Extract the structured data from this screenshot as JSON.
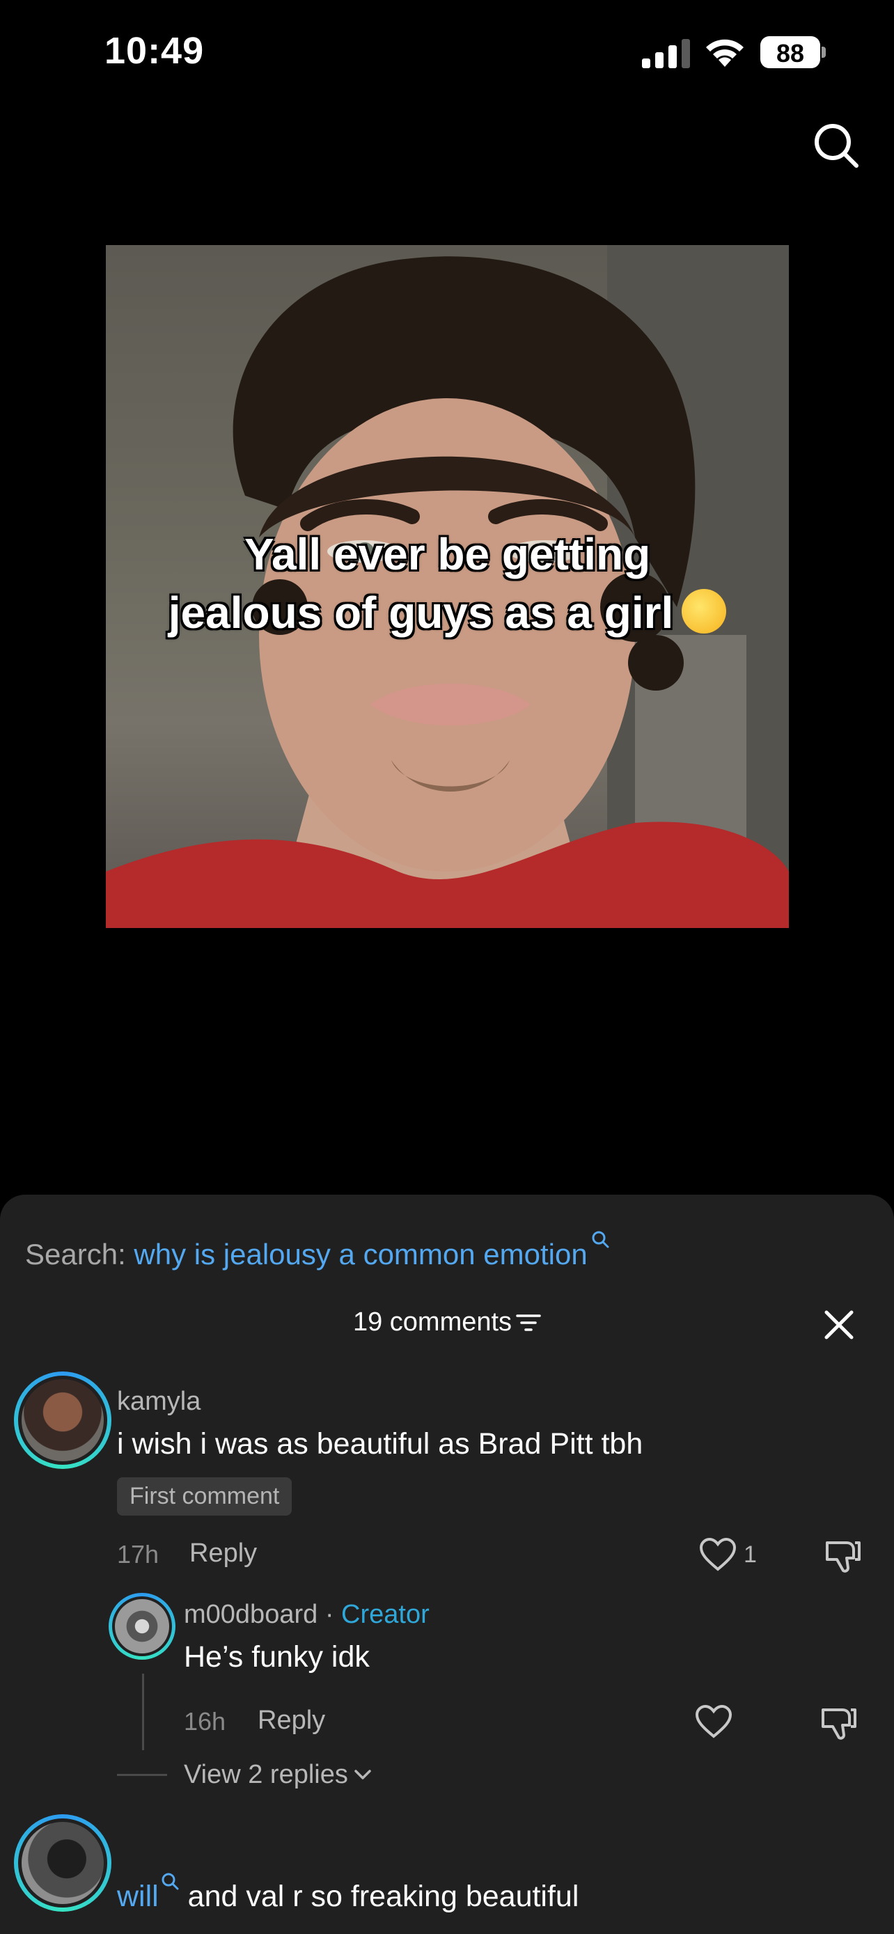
{
  "status_bar": {
    "time": "10:49",
    "battery": "88"
  },
  "video": {
    "caption_line1": "Yall ever be getting",
    "caption_line2": "jealous of guys as a girl",
    "caption_emoji": "sweat-smile-emoji"
  },
  "sheet": {
    "search_label": "Search:",
    "search_query": "why is jealousy a common emotion",
    "comments_count": "19 comments",
    "accent_color": "#53a8f0"
  },
  "comments": [
    {
      "username": "kamyla",
      "text": "i wish i was as beautiful as Brad Pitt tbh",
      "badge": "First comment",
      "time": "17h",
      "reply": "Reply",
      "likes": "1"
    },
    {
      "username": "m00dboard",
      "separator": "·",
      "role": "Creator",
      "text": "He’s funky idk",
      "time": "16h",
      "reply": "Reply"
    },
    {
      "view_replies": "View 2 replies"
    },
    {
      "username": "will",
      "text": "and val r so freaking beautiful"
    }
  ]
}
